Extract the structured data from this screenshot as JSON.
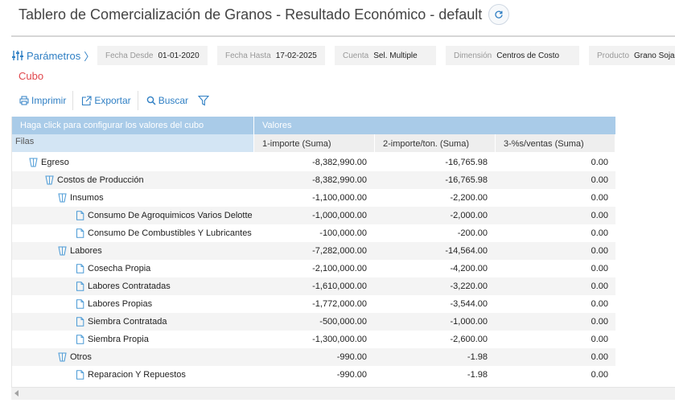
{
  "header": {
    "title": "Tablero de Comercialización de Granos - Resultado Económico - default",
    "refresh_icon": "refresh-icon"
  },
  "params": {
    "toggle_label": "Parámetros",
    "chevron": "〉",
    "items": [
      {
        "label": "Fecha Desde",
        "value": "01-01-2020"
      },
      {
        "label": "Fecha Hasta",
        "value": "17-02-2025"
      },
      {
        "label": "Cuenta",
        "value": "Sel. Multiple"
      },
      {
        "label": "Dimensión",
        "value": "Centros de Costo"
      },
      {
        "label": "Producto",
        "value": "Grano Soja"
      }
    ]
  },
  "cube": {
    "title": "Cubo"
  },
  "toolbar": {
    "print_label": "Imprimir",
    "export_label": "Exportar",
    "search_label": "Buscar"
  },
  "grid": {
    "config_header": "Haga click para configurar los valores del cubo",
    "rows_header": "Filas",
    "values_header": "Valores",
    "columns": [
      "1-importe (Suma)",
      "2-importe/ton. (Suma)",
      "3-%s/ventas (Suma)"
    ],
    "rows": [
      {
        "label": "Egreso",
        "level": 0,
        "type": "folder",
        "values": [
          "-8,382,990.00",
          "-16,765.98",
          "0.00"
        ]
      },
      {
        "label": "Costos de Producción",
        "level": 1,
        "type": "folder",
        "values": [
          "-8,382,990.00",
          "-16,765.98",
          "0.00"
        ]
      },
      {
        "label": "Insumos",
        "level": 2,
        "type": "folder",
        "values": [
          "-1,100,000.00",
          "-2,200.00",
          "0.00"
        ]
      },
      {
        "label": "Consumo De Agroquimicos Varios Delotte",
        "level": 3,
        "type": "doc",
        "values": [
          "-1,000,000.00",
          "-2,000.00",
          "0.00"
        ]
      },
      {
        "label": "Consumo De Combustibles Y Lubricantes",
        "level": 3,
        "type": "doc",
        "values": [
          "-100,000.00",
          "-200.00",
          "0.00"
        ]
      },
      {
        "label": "Labores",
        "level": 2,
        "type": "folder",
        "values": [
          "-7,282,000.00",
          "-14,564.00",
          "0.00"
        ]
      },
      {
        "label": "Cosecha Propia",
        "level": 3,
        "type": "doc",
        "values": [
          "-2,100,000.00",
          "-4,200.00",
          "0.00"
        ]
      },
      {
        "label": "Labores Contratadas",
        "level": 3,
        "type": "doc",
        "values": [
          "-1,610,000.00",
          "-3,220.00",
          "0.00"
        ]
      },
      {
        "label": "Labores Propias",
        "level": 3,
        "type": "doc",
        "values": [
          "-1,772,000.00",
          "-3,544.00",
          "0.00"
        ]
      },
      {
        "label": "Siembra Contratada",
        "level": 3,
        "type": "doc",
        "values": [
          "-500,000.00",
          "-1,000.00",
          "0.00"
        ]
      },
      {
        "label": "Siembra Propia",
        "level": 3,
        "type": "doc",
        "values": [
          "-1,300,000.00",
          "-2,600.00",
          "0.00"
        ]
      },
      {
        "label": "Otros",
        "level": 2,
        "type": "folder",
        "values": [
          "-990.00",
          "-1.98",
          "0.00"
        ]
      },
      {
        "label": "Reparacion Y Repuestos",
        "level": 3,
        "type": "doc",
        "values": [
          "-990.00",
          "-1.98",
          "0.00"
        ]
      }
    ]
  },
  "colors": {
    "accent": "#2f7fc4",
    "cube_title": "#e0474c",
    "header_blue": "#a9cbe8",
    "header_light_blue": "#d3e5f4"
  }
}
